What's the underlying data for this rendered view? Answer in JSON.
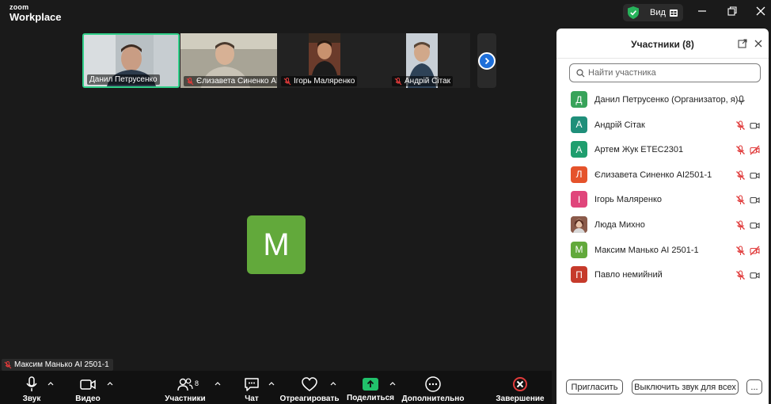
{
  "app": {
    "logo_line1": "zoom",
    "logo_line2": "Workplace"
  },
  "titlebar": {
    "view_label": "Вид"
  },
  "strip": {
    "tiles": [
      {
        "name": "Данил Петрусенко",
        "muted": false,
        "active": true
      },
      {
        "name": "Єлизавета Синенко AI...",
        "muted": true,
        "active": false
      },
      {
        "name": "Ігорь Маляренко",
        "muted": true,
        "active": false
      },
      {
        "name": "Андрій Сітак",
        "muted": true,
        "active": false
      }
    ]
  },
  "main": {
    "avatar_letter": "М",
    "self_label": "Максим Манько AI 2501-1"
  },
  "toolbar": {
    "audio": "Звук",
    "video": "Видео",
    "participants": "Участники",
    "participants_count": "8",
    "chat": "Чат",
    "react": "Отреагировать",
    "share": "Поделиться",
    "more": "Дополнительно",
    "end": "Завершение"
  },
  "panel": {
    "title": "Участники (8)",
    "search_placeholder": "Найти участника",
    "participants": [
      {
        "letter": "Д",
        "name": "Данил Петрусенко (Организатор, я)",
        "color": "#38a35a",
        "mic_muted": false,
        "video_off": false,
        "photo": false
      },
      {
        "letter": "А",
        "name": "Андрій Сітак",
        "color": "#1f8f7a",
        "mic_muted": true,
        "video_off": false,
        "photo": false
      },
      {
        "letter": "А",
        "name": "Артем Жук ЕТЕС2301",
        "color": "#1f9e6e",
        "mic_muted": true,
        "video_off": true,
        "photo": false
      },
      {
        "letter": "Л",
        "name": "Єлизавета Синенко AI2501-1",
        "color": "#e5532b",
        "mic_muted": true,
        "video_off": false,
        "photo": false
      },
      {
        "letter": "І",
        "name": "Ігорь Маляренко",
        "color": "#e0457b",
        "mic_muted": true,
        "video_off": false,
        "photo": false
      },
      {
        "letter": "",
        "name": "Люда Михно",
        "color": "#8a5a4a",
        "mic_muted": true,
        "video_off": false,
        "photo": true
      },
      {
        "letter": "М",
        "name": "Максим Манько AI 2501-1",
        "color": "#62a93b",
        "mic_muted": true,
        "video_off": true,
        "photo": false
      },
      {
        "letter": "П",
        "name": "Павло немийний",
        "color": "#c63a2b",
        "mic_muted": true,
        "video_off": false,
        "photo": false
      }
    ],
    "invite": "Пригласить",
    "mute_all": "Выключить звук для всех",
    "more": "..."
  }
}
